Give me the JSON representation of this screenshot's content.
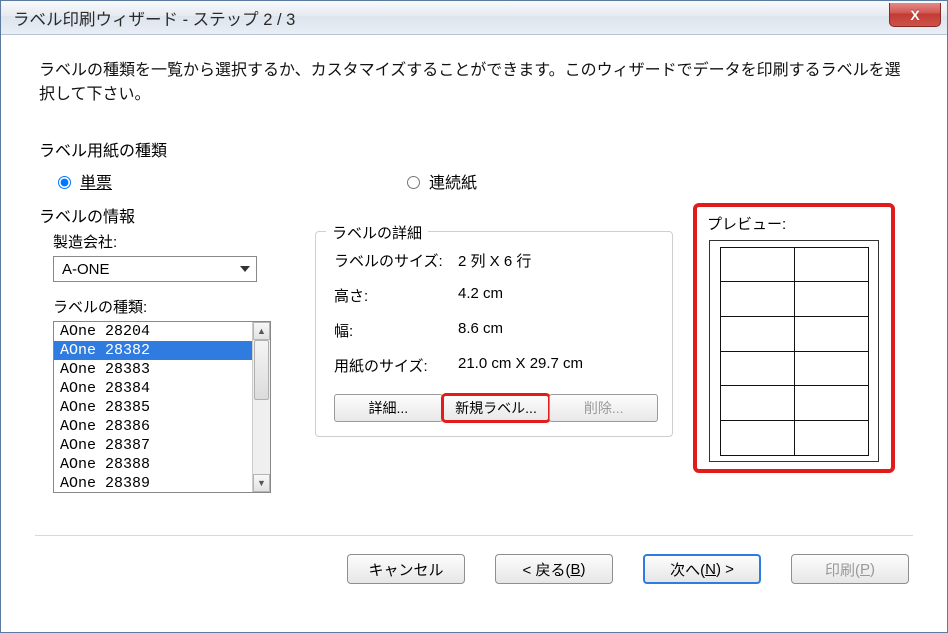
{
  "window": {
    "title": "ラベル印刷ウィザード - ステップ 2 / 3",
    "close_icon": "X"
  },
  "intro": "ラベルの種類を一覧から選択するか、カスタマイズすることができます。このウィザードでデータを印刷するラベルを選択して下さい。",
  "paper_type": {
    "label": "ラベル用紙の種類",
    "options": {
      "cut_sheet": "単票",
      "continuous": "連続紙"
    },
    "selected": "cut_sheet"
  },
  "label_info": {
    "heading": "ラベルの情報",
    "manufacturer_label": "製造会社:",
    "manufacturer_value": "A-ONE",
    "type_label": "ラベルの種類:",
    "types": [
      "AOne 28204",
      "AOne 28382",
      "AOne 28383",
      "AOne 28384",
      "AOne 28385",
      "AOne 28386",
      "AOne 28387",
      "AOne 28388",
      "AOne 28389"
    ],
    "selected_index": 1
  },
  "details": {
    "legend": "ラベルの詳細",
    "rows": {
      "size_label": "ラベルのサイズ:",
      "size_value": "2 列 X 6 行",
      "height_label": "高さ:",
      "height_value": "4.2 cm",
      "width_label": "幅:",
      "width_value": "8.6 cm",
      "paper_label": "用紙のサイズ:",
      "paper_value": "21.0 cm X 29.7 cm"
    },
    "buttons": {
      "detail": "詳細...",
      "new": "新規ラベル...",
      "delete": "削除..."
    }
  },
  "preview": {
    "label": "プレビュー:",
    "cols": 2,
    "rows": 6
  },
  "footer": {
    "cancel": "キャンセル",
    "back_prefix": "< 戻る(",
    "back_m": "B",
    "back_suffix": ")",
    "next_prefix": "次へ(",
    "next_m": "N",
    "next_suffix": ") >",
    "print_prefix": "印刷(",
    "print_m": "P",
    "print_suffix": ")"
  }
}
